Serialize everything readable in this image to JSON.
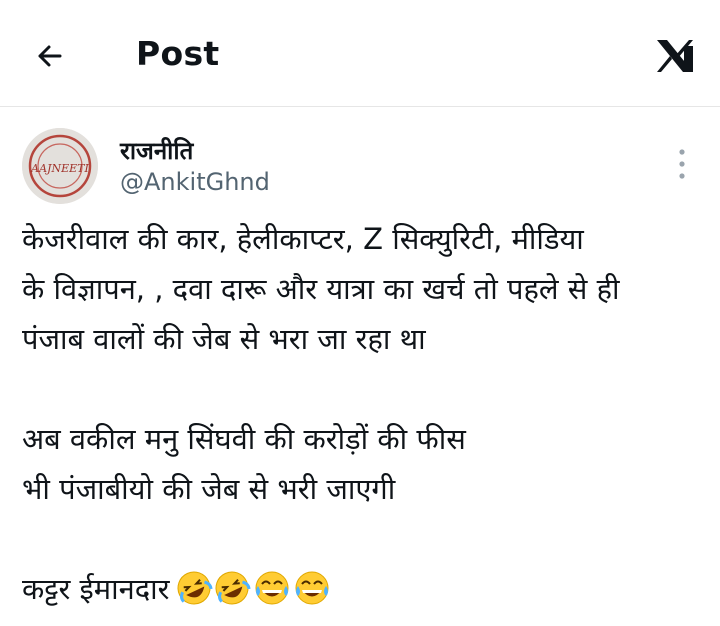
{
  "header": {
    "title": "Post",
    "back_icon": "arrow-left-icon",
    "logo_icon": "x-logo-icon"
  },
  "post": {
    "author": {
      "display_name": "राजनीति",
      "handle": "@AnkitGhnd",
      "avatar_text": "AAJNEETI"
    },
    "text_lines": [
      "केजरीवाल की कार, हेलीकाप्टर, Z सिक्युरिटी, मीडिया",
      "के विज्ञापन, , दवा दारू और यात्रा का खर्च तो पहले से ही",
      "पंजाब वालों की जेब से भरा जा रहा था",
      "",
      "अब वकील मनु सिंघवी की करोड़ों की फीस",
      "भी पंजाबीयो की जेब से भरी जाएगी",
      "",
      "कट्टर ईमानदार"
    ],
    "trailing_emojis": [
      "rofl-emoji",
      "rofl-emoji",
      "tears-of-joy-emoji",
      "tears-of-joy-emoji"
    ]
  }
}
